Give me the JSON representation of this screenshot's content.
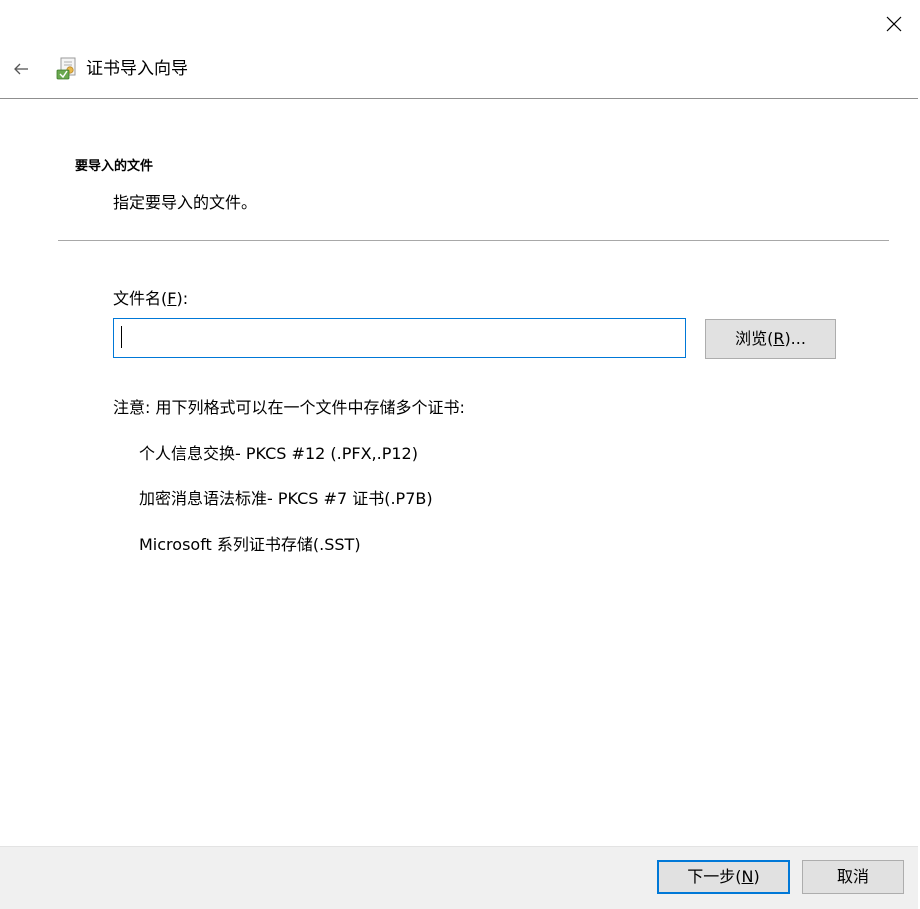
{
  "window": {
    "close_icon": "close-icon"
  },
  "header": {
    "back_icon": "back-arrow-icon",
    "wizard_icon": "certificate-icon",
    "title": "证书导入向导"
  },
  "section": {
    "heading": "要导入的文件",
    "description": "指定要导入的文件。"
  },
  "file": {
    "label_prefix": "文件名(",
    "label_accel": "F",
    "label_suffix": "):",
    "value": "",
    "browse_prefix": "浏览(",
    "browse_accel": "R",
    "browse_suffix": ")..."
  },
  "note": {
    "text": "注意: 用下列格式可以在一个文件中存储多个证书:",
    "formats": [
      "个人信息交换- PKCS #12 (.PFX,.P12)",
      "加密消息语法标准- PKCS #7 证书(.P7B)",
      "Microsoft 系列证书存储(.SST)"
    ]
  },
  "footer": {
    "next_prefix": "下一步(",
    "next_accel": "N",
    "next_suffix": ")",
    "cancel_label": "取消"
  },
  "colors": {
    "accent": "#0078d7",
    "footer_bg": "#f0f0f0",
    "button_bg": "#e1e1e1"
  }
}
